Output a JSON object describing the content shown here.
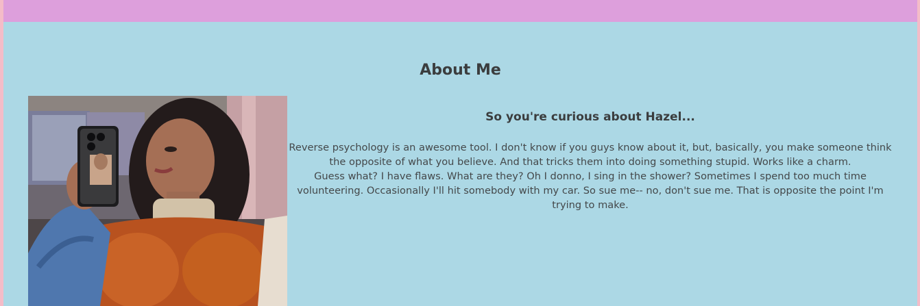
{
  "header": {
    "background_color": "#dd9fdc"
  },
  "page": {
    "background_color": "#acd8e5",
    "border_color": "#f4bcc8"
  },
  "about": {
    "title": "About Me",
    "subheading": "So you're curious about Hazel...",
    "photo_icon": "profile-photo",
    "paragraph_1": "Reverse psychology is an awesome tool. I don't know if you guys know about it, but, basically, you make someone think the opposite of what you believe. And that tricks them into doing something stupid. Works like a charm.",
    "paragraph_2": "Guess what? I have flaws. What are they? Oh I donno, I sing in the shower? Sometimes I spend too much time volunteering. Occasionally I'll hit somebody with my car. So sue me-- no, don't sue me. That is opposite the point I'm trying to make."
  }
}
